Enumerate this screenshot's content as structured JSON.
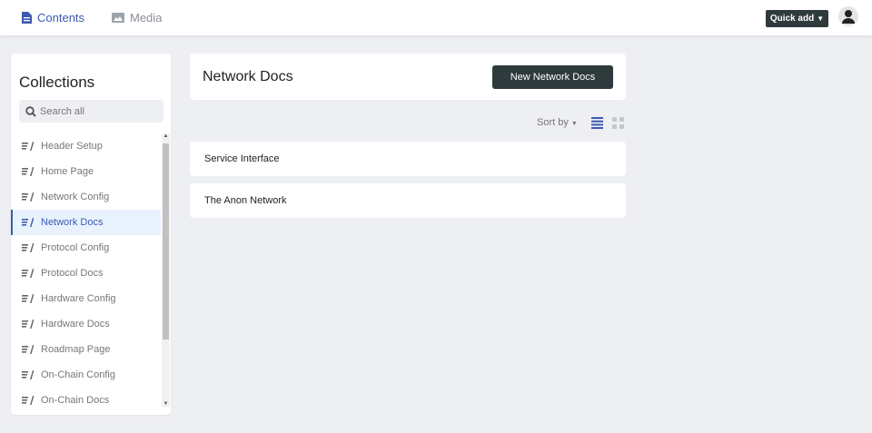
{
  "nav": {
    "contents": "Contents",
    "media": "Media",
    "quick_add": "Quick add"
  },
  "sidebar": {
    "title": "Collections",
    "search_placeholder": "Search all",
    "selected": "Network Docs",
    "items": [
      "Header Setup",
      "Home Page",
      "Network Config",
      "Network Docs",
      "Protocol Config",
      "Protocol Docs",
      "Hardware Config",
      "Hardware Docs",
      "Roadmap Page",
      "On-Chain Config",
      "On-Chain Docs"
    ]
  },
  "main": {
    "title": "Network Docs",
    "new_button": "New Network Docs",
    "sort_label": "Sort by",
    "entries": [
      "Service Interface",
      "The Anon Network"
    ]
  },
  "colors": {
    "accent": "#3c5ab0",
    "dark_button": "#2e3a3c"
  }
}
